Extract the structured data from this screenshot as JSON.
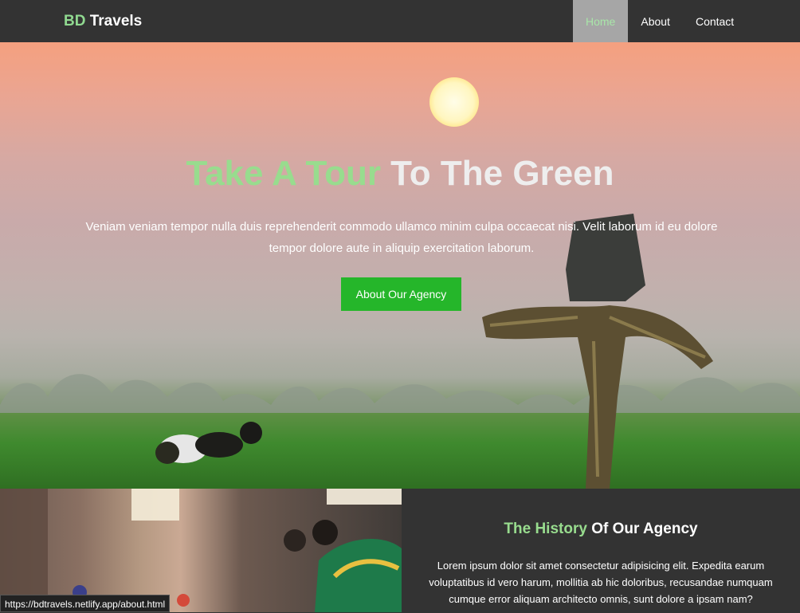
{
  "nav": {
    "brand_highlight": "BD",
    "brand_rest": " Travels",
    "items": [
      {
        "label": "Home"
      },
      {
        "label": "About"
      },
      {
        "label": "Contact"
      }
    ]
  },
  "hero": {
    "title_highlight": "Take A Tour",
    "title_rest": " To The Green",
    "text": "Veniam veniam tempor nulla duis reprehenderit commodo ullamco minim culpa occaecat nisi. Velit laborum id eu dolore tempor dolore aute in aliquip exercitation laborum.",
    "button_label": "About Our Agency"
  },
  "history": {
    "title_highlight": "The History",
    "title_rest": " Of Our Agency",
    "text": "Lorem ipsum dolor sit amet consectetur adipisicing elit. Expedita earum voluptatibus id vero harum, mollitia ab hic doloribus, recusandae numquam cumque error aliquam architecto omnis, sunt dolore a ipsam nam?"
  },
  "status_bar": {
    "url": "https://bdtravels.netlify.app/about.html"
  },
  "colors": {
    "accent_green": "#98dc8e",
    "button_green": "#25b62a",
    "nav_bg": "#333333",
    "nav_active_bg": "#a6a6a6"
  }
}
